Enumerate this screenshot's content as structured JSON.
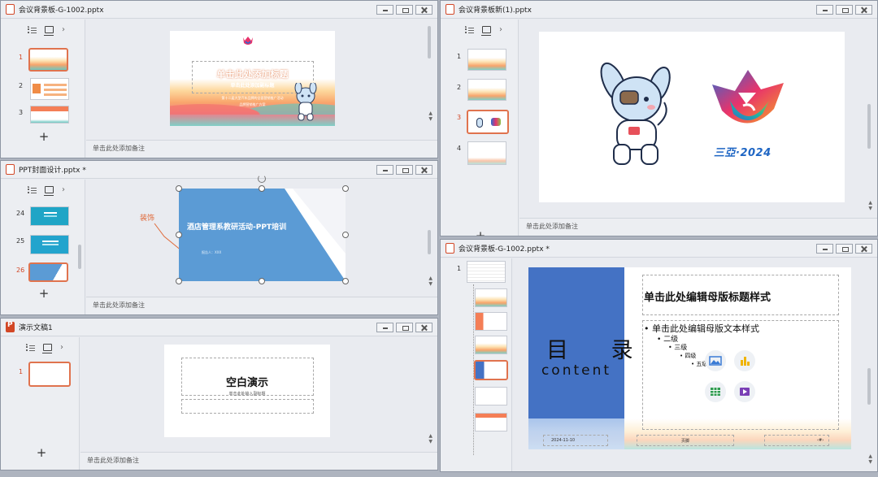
{
  "windows": [
    {
      "title": "会议背景板-G-1002.pptx",
      "slide_numbers": [
        "1",
        "2",
        "3"
      ],
      "slide": {
        "title": "单击此处添加标题",
        "subtitle": "单击此处添加副标题",
        "line1": "第十二届大型汽车品牌的全面营销推广活动",
        "line2": "品牌营销推广方案"
      },
      "notes": "单击此处添加备注"
    },
    {
      "title": "PPT封面设计.pptx *",
      "slide_numbers": [
        "24",
        "25",
        "26"
      ],
      "callout": "装饰",
      "slide": {
        "title": "酒店管理系教研活动-PPT培训",
        "small": "报告人：XXX"
      },
      "notes": "单击此处添加备注"
    },
    {
      "title": "演示文稿1",
      "slide_numbers": [
        "1"
      ],
      "slide": {
        "title": "空白演示",
        "subtitle": "单击此处输入副标题"
      },
      "notes": "单击此处添加备注"
    },
    {
      "title": "会议背景板新(1).pptx",
      "slide_numbers": [
        "1",
        "2",
        "3",
        "4"
      ],
      "slide": {
        "logo_text": "三亞·2024"
      },
      "notes": "单击此处添加备注"
    },
    {
      "title": "会议背景板-G-1002.pptx *",
      "slide_numbers": [
        "1"
      ],
      "slide": {
        "toc_title": "目 录",
        "toc_en": "content",
        "master_title": "单击此处编辑母版标题样式",
        "bullets": [
          "单击此处编辑母版文本样式",
          "二级",
          "三级",
          "四级",
          "五级"
        ],
        "footer_date": "2024-11-10",
        "footer_mid": "页脚"
      }
    }
  ],
  "colors": {
    "accent_orange": "#e0734e",
    "blue_slide": "#5b9bd5",
    "toc_blue": "#4472c4"
  }
}
